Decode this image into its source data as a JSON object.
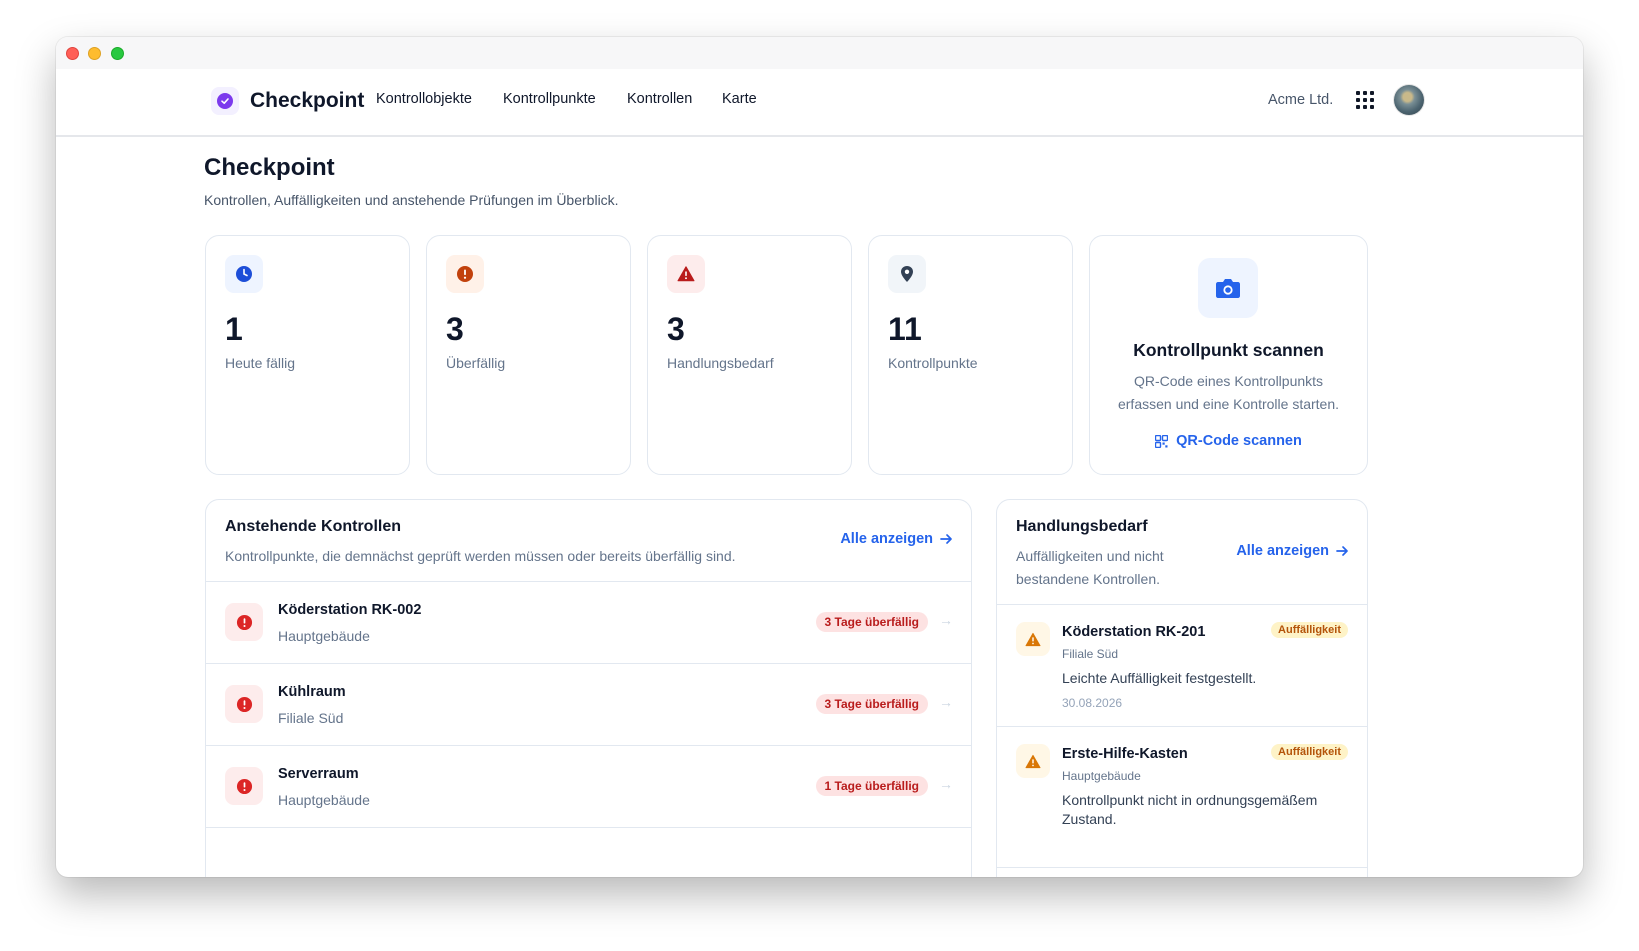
{
  "colors": {
    "accent": "#2563eb",
    "brand": "#7c3aed",
    "danger": "#dc2626",
    "warning": "#d97706"
  },
  "nav": {
    "brand": "Checkpoint",
    "links": [
      "Kontrollobjekte",
      "Kontrollpunkte",
      "Kontrollen",
      "Karte"
    ],
    "org": "Acme Ltd."
  },
  "page": {
    "title": "Checkpoint",
    "subtitle": "Kontrollen, Auffälligkeiten und anstehende Prüfungen im Überblick."
  },
  "stats": [
    {
      "value": "1",
      "label": "Heute fällig",
      "icon": "clock-icon"
    },
    {
      "value": "3",
      "label": "Überfällig",
      "icon": "alert-circle-icon"
    },
    {
      "value": "3",
      "label": "Handlungsbedarf",
      "icon": "warning-triangle-icon"
    },
    {
      "value": "11",
      "label": "Kontrollpunkte",
      "icon": "map-pin-icon"
    }
  ],
  "scan": {
    "title": "Kontrollpunkt scannen",
    "description": "QR-Code eines Kontrollpunkts erfassen und eine Kontrolle starten.",
    "link": "QR-Code scannen"
  },
  "upcoming": {
    "title": "Anstehende Kontrollen",
    "description": "Kontrollpunkte, die demnächst geprüft werden müssen oder bereits überfällig sind.",
    "link": "Alle anzeigen",
    "items": [
      {
        "name": "Köderstation RK-002",
        "location": "Hauptgebäude",
        "status": "3 Tage überfällig"
      },
      {
        "name": "Kühlraum",
        "location": "Filiale Süd",
        "status": "3 Tage überfällig"
      },
      {
        "name": "Serverraum",
        "location": "Hauptgebäude",
        "status": "1 Tage überfällig"
      }
    ]
  },
  "action": {
    "title": "Handlungsbedarf",
    "description": "Auffälligkeiten und nicht bestandene Kontrollen.",
    "link": "Alle anzeigen",
    "items": [
      {
        "name": "Köderstation RK-201",
        "location": "Filiale Süd",
        "text": "Leichte Auffälligkeit festgestellt.",
        "date": "30.08.2026",
        "badge": "Auffälligkeit"
      },
      {
        "name": "Erste-Hilfe-Kasten",
        "location": "Hauptgebäude",
        "text": "Kontrollpunkt nicht in ordnungsgemäßem Zustand.",
        "date": "",
        "badge": "Auffälligkeit"
      }
    ]
  }
}
